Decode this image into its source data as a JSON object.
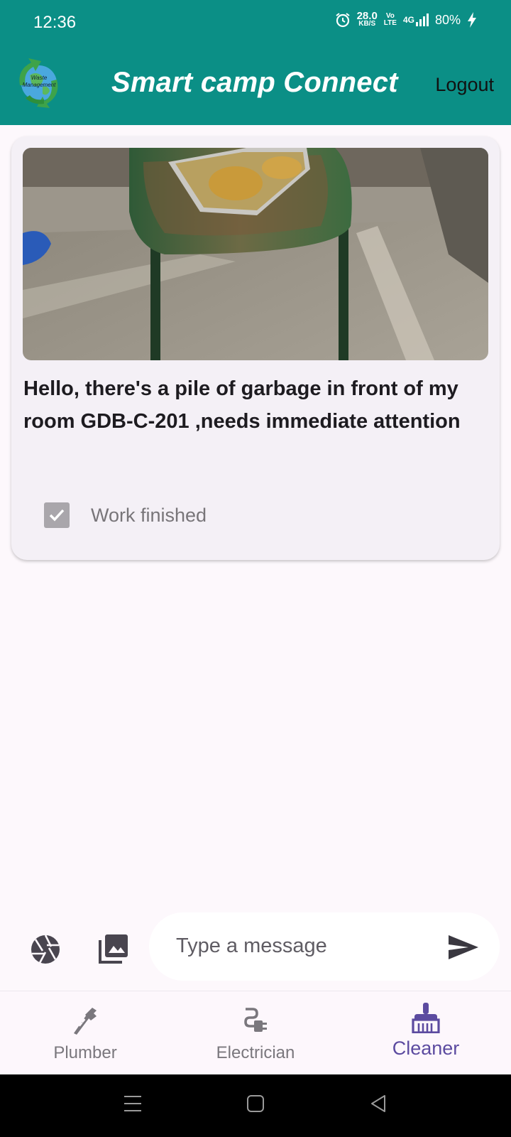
{
  "status_bar": {
    "time": "12:36",
    "net_speed": "28.0",
    "net_unit": "KB/S",
    "volte_top": "Vo",
    "volte_bottom": "LTE",
    "network": "4G",
    "battery": "80%",
    "icons": [
      "alarm-icon",
      "signal-icon",
      "charging-icon"
    ]
  },
  "app_bar": {
    "logo_text": "Waste Management",
    "title": "Smart camp Connect",
    "logout_label": "Logout",
    "background": "#0b8f86"
  },
  "post": {
    "image": "photo of green table with food tray in a corridor",
    "message": "Hello, there's a pile of garbage in front of my room GDB-C-201 ,needs immediate attention",
    "work_finished_label": "Work finished",
    "work_finished_checked": true
  },
  "composer": {
    "camera_icon": "camera-shutter-icon",
    "gallery_icon": "photo-library-icon",
    "placeholder": "Type a message",
    "value": "",
    "send_icon": "send-icon"
  },
  "bottom_nav": {
    "items": [
      {
        "label": "Plumber",
        "icon": "plumbing-icon",
        "active": false
      },
      {
        "label": "Electrician",
        "icon": "electrical-plug-icon",
        "active": false
      },
      {
        "label": "Cleaner",
        "icon": "broom-icon",
        "active": true
      }
    ],
    "active_color": "#5c4ba0"
  },
  "system_nav": [
    "menu-icon",
    "home-icon",
    "back-icon"
  ]
}
